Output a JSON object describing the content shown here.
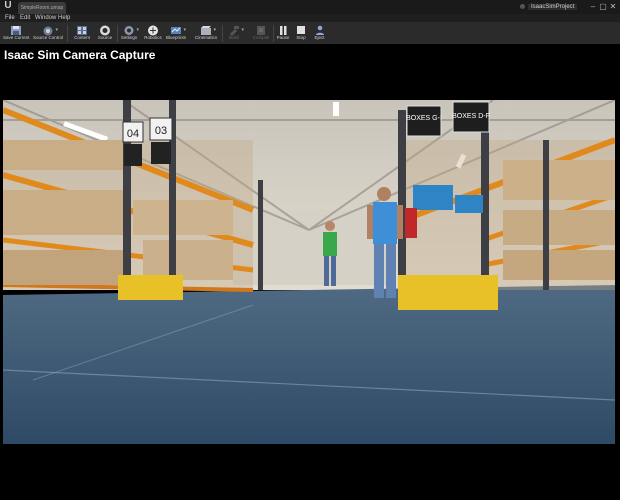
{
  "window": {
    "doc_tab": "SimpleRoom.umap",
    "project_name": "IsaacSimProject",
    "controls": [
      "–",
      "▢",
      "✕"
    ]
  },
  "menu": [
    "File",
    "Edit",
    "Window",
    "Help"
  ],
  "toolbar": [
    {
      "label": "Save Current",
      "icon": "save-icon",
      "enabled": true
    },
    {
      "label": "Source Control",
      "icon": "source-control-icon",
      "enabled": true
    },
    {
      "label": "Content",
      "icon": "content-icon",
      "enabled": true
    },
    {
      "label": "Source",
      "icon": "source-icon",
      "enabled": true
    },
    {
      "label": "Settings",
      "icon": "settings-icon",
      "enabled": true
    },
    {
      "label": "Robotics",
      "icon": "robotics-icon",
      "enabled": true
    },
    {
      "label": "Blueprints",
      "icon": "blueprints-icon",
      "enabled": true
    },
    {
      "label": "Cinematics",
      "icon": "cinematics-icon",
      "enabled": true
    },
    {
      "label": "Build",
      "icon": "build-icon",
      "enabled": false
    },
    {
      "label": "Compile",
      "icon": "compile-icon",
      "enabled": false
    },
    {
      "label": "Pause",
      "icon": "pause-icon",
      "enabled": true
    },
    {
      "label": "Stop",
      "icon": "stop-icon",
      "enabled": true
    },
    {
      "label": "Eject",
      "icon": "eject-icon",
      "enabled": true
    }
  ],
  "viewport": {
    "caption": "Isaac Sim Camera Capture",
    "signs": [
      "04",
      "03",
      "BOXES G-I",
      "BOXES D-F"
    ]
  }
}
